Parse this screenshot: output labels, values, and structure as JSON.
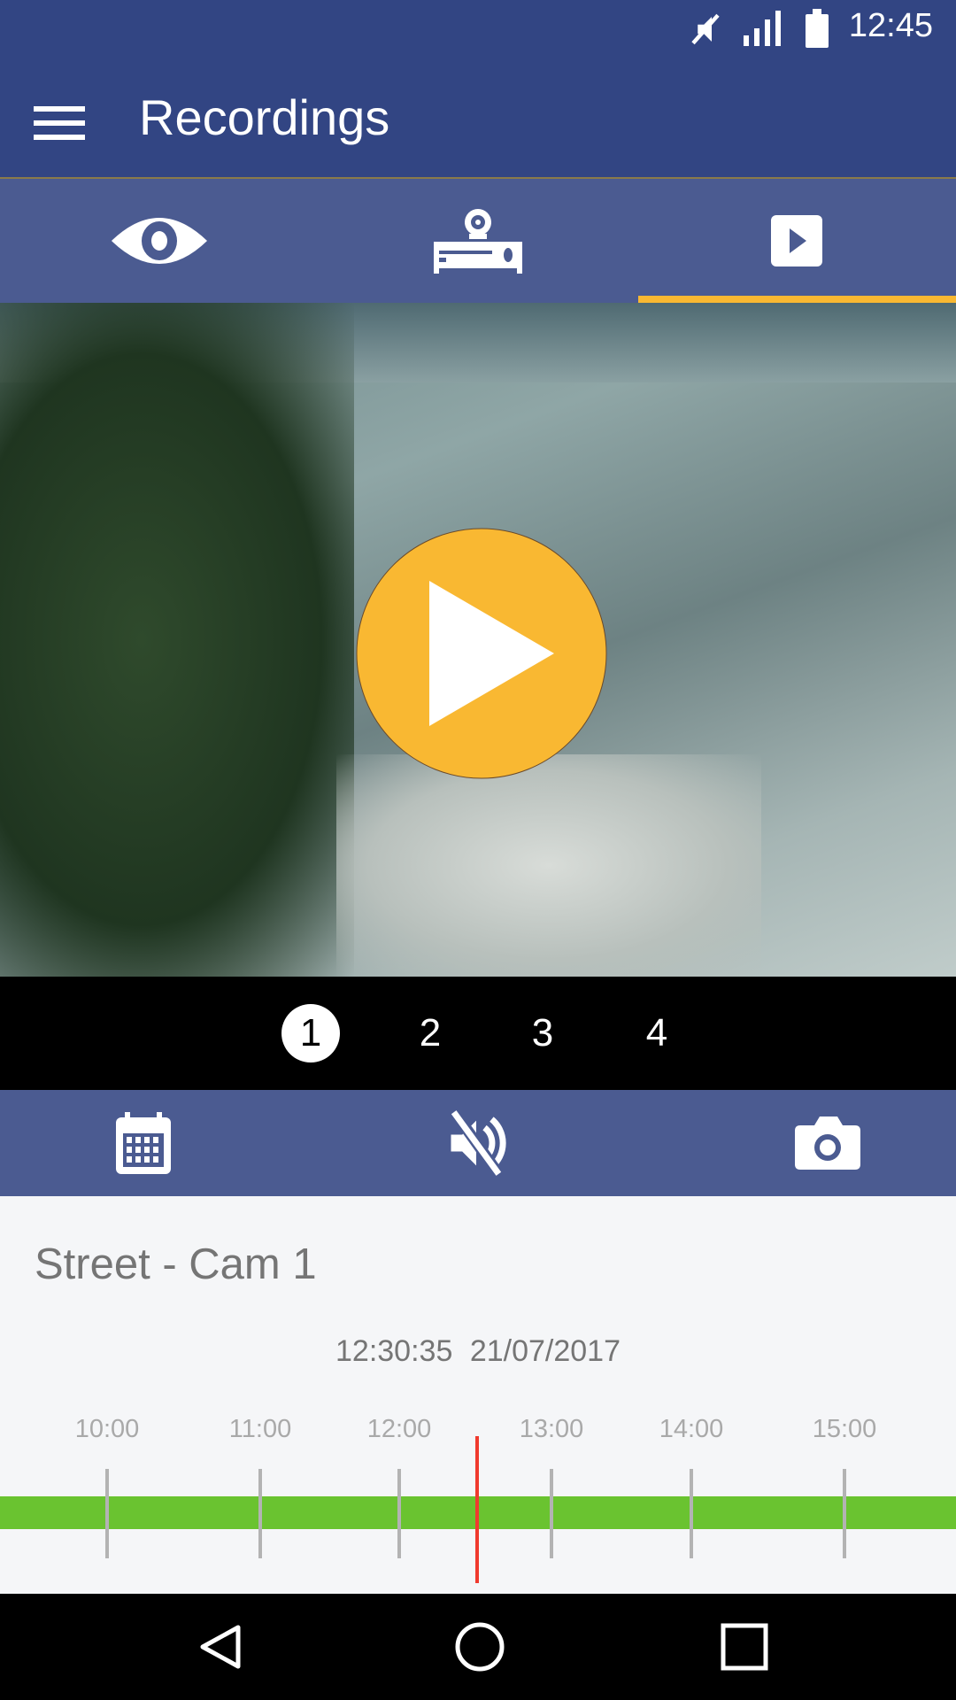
{
  "status_bar": {
    "time": "12:45",
    "icons": [
      "mute-icon",
      "signal-icon",
      "battery-icon"
    ]
  },
  "app_bar": {
    "title": "Recordings",
    "menu_icon": "hamburger-menu-icon"
  },
  "tabs": [
    {
      "name": "live",
      "icon": "eye-icon",
      "active": false
    },
    {
      "name": "devices",
      "icon": "camera-recorder-icon",
      "active": false
    },
    {
      "name": "recordings",
      "icon": "play-box-icon",
      "active": true
    }
  ],
  "player": {
    "play_icon": "play-icon"
  },
  "pager": {
    "pages": [
      "1",
      "2",
      "3",
      "4"
    ],
    "active": "1"
  },
  "controls": [
    {
      "icon": "calendar-icon"
    },
    {
      "icon": "volume-off-icon"
    },
    {
      "icon": "camera-snapshot-icon"
    }
  ],
  "camera_name": "Street - Cam 1",
  "timestamp": {
    "time": "12:30:35",
    "date": "21/07/2017"
  },
  "timeline": {
    "labels": [
      "10:00",
      "11:00",
      "12:00",
      "13:00",
      "14:00",
      "15:00"
    ],
    "cursor": "12:30:35",
    "recording_color": "#6ac330",
    "cursor_color": "#f03a2e"
  },
  "colors": {
    "app_bar": "#324583",
    "tab_bar": "#4b5b91",
    "accent": "#f9b832"
  }
}
